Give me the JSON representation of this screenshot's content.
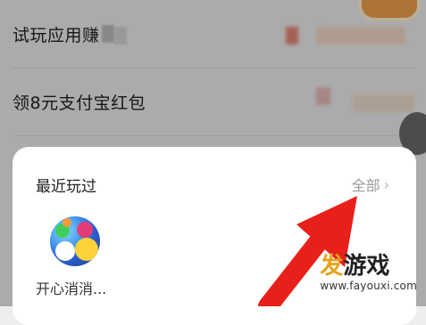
{
  "background": {
    "rows": [
      {
        "label": "试玩应用赚"
      },
      {
        "label": "领8元支付宝红包"
      }
    ]
  },
  "card": {
    "title": "最近玩过",
    "see_all": "全部",
    "see_all_chevron": "›",
    "games": [
      {
        "name": "开心消消...",
        "icon": "happy-match-game-icon"
      }
    ]
  },
  "watermark": {
    "logo_part1": "发",
    "logo_part2": "游戏",
    "url": "www.fayouxi.com"
  },
  "colors": {
    "arrow": "#e8201a",
    "logo_accent": "#e8a21a"
  }
}
